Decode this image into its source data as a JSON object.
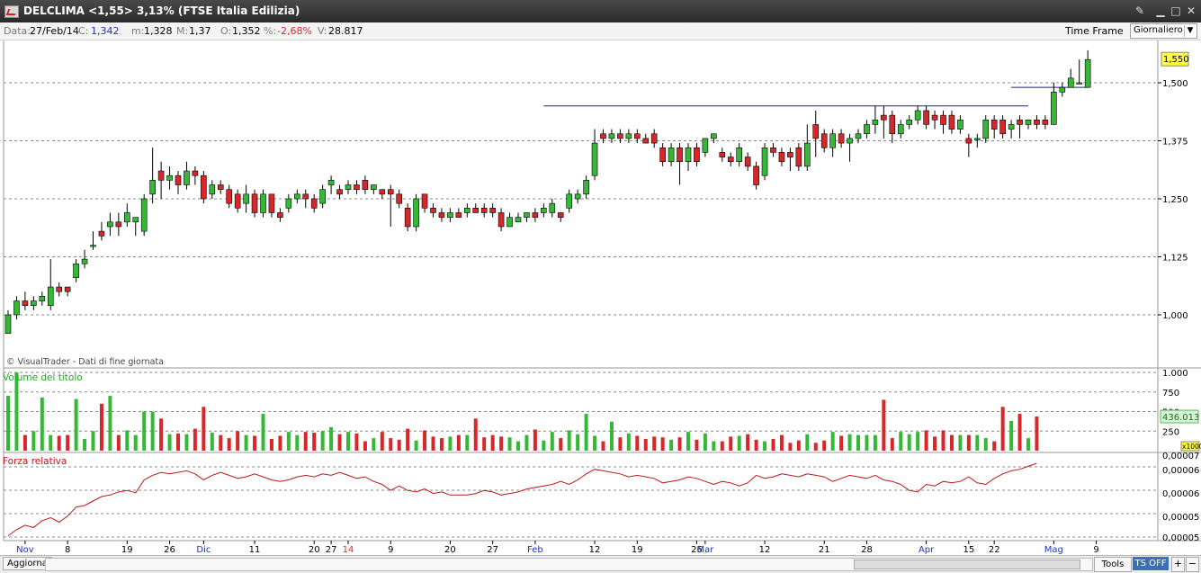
{
  "window": {
    "title": "DELCLIMA <1,55> 3,13%  (FTSE Italia Edilizia)"
  },
  "infobar": {
    "date_label": "Data:",
    "date_value": "27/Feb/14",
    "close_label": "C:",
    "close_value": "1,342",
    "min_label": "m:",
    "min_value": "1,328",
    "max_label": "M:",
    "max_value": "1,37",
    "open_label": "O:",
    "open_value": "1,352",
    "pct_label": "%:",
    "pct_value": "-2,68%",
    "vol_label": "V:",
    "vol_value": "28.817",
    "timeframe_label": "Time Frame",
    "timeframe_value": "Giornaliero"
  },
  "footer": {
    "refresh_label": "Aggiorna",
    "tools_label": "Tools",
    "ts_label": "TS OFF"
  },
  "colors": {
    "up": "#35b835",
    "down": "#d7272b",
    "line": "#1e1e96",
    "rs": "#c01818"
  },
  "chart_data": {
    "type": "candlestick",
    "copyright": "© VisualTrader - Dati di fine giornata",
    "price_axis": {
      "ticks": [
        1.0,
        1.125,
        1.25,
        1.375,
        1.5
      ],
      "labels": [
        "1,000",
        "1,125",
        "1,250",
        "1,375",
        "1,500"
      ],
      "last_label": "1,550",
      "last_value": 1.55
    },
    "date_labels": [
      {
        "i": 2,
        "label": "Nov",
        "color": "#2030c0"
      },
      {
        "i": 7,
        "label": "8"
      },
      {
        "i": 14,
        "label": "19"
      },
      {
        "i": 19,
        "label": "26"
      },
      {
        "i": 23,
        "label": "Dic",
        "color": "#2030c0"
      },
      {
        "i": 29,
        "label": "11"
      },
      {
        "i": 36,
        "label": "20"
      },
      {
        "i": 38,
        "label": "27"
      },
      {
        "i": 40,
        "label": "14",
        "color": "#e0282e"
      },
      {
        "i": 45,
        "label": "9"
      },
      {
        "i": 52,
        "label": "20"
      },
      {
        "i": 57,
        "label": "27"
      },
      {
        "i": 62,
        "label": "Feb",
        "color": "#2030c0"
      },
      {
        "i": 69,
        "label": "12"
      },
      {
        "i": 74,
        "label": "19"
      },
      {
        "i": 81,
        "label": "26"
      },
      {
        "i": 82,
        "label": "Mar",
        "color": "#2030c0"
      },
      {
        "i": 89,
        "label": "12"
      },
      {
        "i": 96,
        "label": "21"
      },
      {
        "i": 101,
        "label": "28"
      },
      {
        "i": 108,
        "label": "Apr",
        "color": "#2030c0"
      },
      {
        "i": 113,
        "label": "15"
      },
      {
        "i": 116,
        "label": "22"
      },
      {
        "i": 123,
        "label": "Mag",
        "color": "#2030c0"
      },
      {
        "i": 128,
        "label": "9"
      }
    ],
    "candles": [
      [
        0.96,
        1.0,
        0.96,
        1.01
      ],
      [
        1.0,
        1.03,
        0.99,
        1.04
      ],
      [
        1.03,
        1.02,
        1.01,
        1.05
      ],
      [
        1.02,
        1.03,
        1.01,
        1.04
      ],
      [
        1.03,
        1.04,
        1.02,
        1.05
      ],
      [
        1.02,
        1.06,
        1.01,
        1.12
      ],
      [
        1.06,
        1.05,
        1.04,
        1.07
      ],
      [
        1.06,
        1.05,
        1.04,
        1.06
      ],
      [
        1.08,
        1.11,
        1.07,
        1.12
      ],
      [
        1.11,
        1.12,
        1.1,
        1.14
      ],
      [
        1.15,
        1.15,
        1.14,
        1.18
      ],
      [
        1.18,
        1.17,
        1.16,
        1.2
      ],
      [
        1.19,
        1.2,
        1.17,
        1.22
      ],
      [
        1.2,
        1.19,
        1.17,
        1.22
      ],
      [
        1.2,
        1.22,
        1.19,
        1.24
      ],
      [
        1.2,
        1.21,
        1.17,
        1.21
      ],
      [
        1.18,
        1.25,
        1.17,
        1.26
      ],
      [
        1.26,
        1.29,
        1.24,
        1.36
      ],
      [
        1.31,
        1.29,
        1.25,
        1.33
      ],
      [
        1.29,
        1.3,
        1.27,
        1.32
      ],
      [
        1.3,
        1.28,
        1.26,
        1.31
      ],
      [
        1.28,
        1.31,
        1.27,
        1.33
      ],
      [
        1.31,
        1.3,
        1.28,
        1.32
      ],
      [
        1.3,
        1.25,
        1.24,
        1.31
      ],
      [
        1.26,
        1.28,
        1.25,
        1.29
      ],
      [
        1.28,
        1.27,
        1.26,
        1.29
      ],
      [
        1.27,
        1.24,
        1.23,
        1.28
      ],
      [
        1.26,
        1.23,
        1.22,
        1.27
      ],
      [
        1.24,
        1.26,
        1.22,
        1.28
      ],
      [
        1.26,
        1.22,
        1.21,
        1.27
      ],
      [
        1.22,
        1.26,
        1.21,
        1.27
      ],
      [
        1.26,
        1.22,
        1.21,
        1.26
      ],
      [
        1.22,
        1.21,
        1.2,
        1.23
      ],
      [
        1.23,
        1.25,
        1.22,
        1.26
      ],
      [
        1.25,
        1.26,
        1.24,
        1.27
      ],
      [
        1.26,
        1.25,
        1.23,
        1.27
      ],
      [
        1.25,
        1.23,
        1.22,
        1.26
      ],
      [
        1.24,
        1.27,
        1.23,
        1.28
      ],
      [
        1.28,
        1.29,
        1.26,
        1.3
      ],
      [
        1.27,
        1.26,
        1.25,
        1.28
      ],
      [
        1.27,
        1.28,
        1.26,
        1.29
      ],
      [
        1.28,
        1.27,
        1.26,
        1.29
      ],
      [
        1.29,
        1.27,
        1.26,
        1.3
      ],
      [
        1.27,
        1.28,
        1.26,
        1.28
      ],
      [
        1.27,
        1.26,
        1.25,
        1.27
      ],
      [
        1.27,
        1.26,
        1.19,
        1.28
      ],
      [
        1.26,
        1.24,
        1.23,
        1.27
      ],
      [
        1.23,
        1.19,
        1.18,
        1.24
      ],
      [
        1.19,
        1.25,
        1.18,
        1.26
      ],
      [
        1.26,
        1.23,
        1.22,
        1.26
      ],
      [
        1.23,
        1.22,
        1.21,
        1.24
      ],
      [
        1.22,
        1.21,
        1.2,
        1.23
      ],
      [
        1.21,
        1.22,
        1.2,
        1.23
      ],
      [
        1.22,
        1.21,
        1.21,
        1.23
      ],
      [
        1.22,
        1.23,
        1.21,
        1.24
      ],
      [
        1.23,
        1.22,
        1.22,
        1.24
      ],
      [
        1.23,
        1.22,
        1.21,
        1.24
      ],
      [
        1.23,
        1.22,
        1.21,
        1.24
      ],
      [
        1.22,
        1.19,
        1.18,
        1.23
      ],
      [
        1.19,
        1.21,
        1.19,
        1.22
      ],
      [
        1.2,
        1.21,
        1.2,
        1.22
      ],
      [
        1.21,
        1.22,
        1.2,
        1.22
      ],
      [
        1.22,
        1.21,
        1.2,
        1.23
      ],
      [
        1.22,
        1.23,
        1.21,
        1.24
      ],
      [
        1.22,
        1.24,
        1.21,
        1.25
      ],
      [
        1.22,
        1.21,
        1.2,
        1.22
      ],
      [
        1.23,
        1.26,
        1.22,
        1.27
      ],
      [
        1.25,
        1.26,
        1.24,
        1.27
      ],
      [
        1.26,
        1.29,
        1.25,
        1.3
      ],
      [
        1.3,
        1.37,
        1.29,
        1.4
      ],
      [
        1.39,
        1.38,
        1.37,
        1.4
      ],
      [
        1.38,
        1.39,
        1.37,
        1.4
      ],
      [
        1.39,
        1.38,
        1.37,
        1.4
      ],
      [
        1.38,
        1.39,
        1.37,
        1.4
      ],
      [
        1.39,
        1.38,
        1.37,
        1.4
      ],
      [
        1.38,
        1.37,
        1.37,
        1.39
      ],
      [
        1.39,
        1.37,
        1.36,
        1.4
      ],
      [
        1.36,
        1.33,
        1.32,
        1.37
      ],
      [
        1.33,
        1.36,
        1.32,
        1.37
      ],
      [
        1.36,
        1.33,
        1.28,
        1.37
      ],
      [
        1.33,
        1.36,
        1.31,
        1.37
      ],
      [
        1.36,
        1.33,
        1.32,
        1.37
      ],
      [
        1.35,
        1.38,
        1.34,
        1.38
      ],
      [
        1.38,
        1.39,
        1.37,
        1.39
      ],
      [
        1.35,
        1.34,
        1.33,
        1.36
      ],
      [
        1.34,
        1.33,
        1.32,
        1.35
      ],
      [
        1.33,
        1.36,
        1.32,
        1.37
      ],
      [
        1.34,
        1.32,
        1.31,
        1.35
      ],
      [
        1.32,
        1.28,
        1.27,
        1.33
      ],
      [
        1.3,
        1.36,
        1.29,
        1.37
      ],
      [
        1.36,
        1.35,
        1.34,
        1.37
      ],
      [
        1.35,
        1.33,
        1.32,
        1.36
      ],
      [
        1.35,
        1.34,
        1.31,
        1.36
      ],
      [
        1.36,
        1.32,
        1.31,
        1.37
      ],
      [
        1.32,
        1.37,
        1.31,
        1.41
      ],
      [
        1.41,
        1.38,
        1.34,
        1.44
      ],
      [
        1.39,
        1.36,
        1.35,
        1.4
      ],
      [
        1.36,
        1.39,
        1.34,
        1.4
      ],
      [
        1.39,
        1.37,
        1.36,
        1.4
      ],
      [
        1.37,
        1.38,
        1.33,
        1.39
      ],
      [
        1.38,
        1.39,
        1.37,
        1.4
      ],
      [
        1.39,
        1.41,
        1.38,
        1.42
      ],
      [
        1.41,
        1.42,
        1.39,
        1.45
      ],
      [
        1.43,
        1.42,
        1.38,
        1.45
      ],
      [
        1.43,
        1.39,
        1.37,
        1.44
      ],
      [
        1.39,
        1.41,
        1.38,
        1.42
      ],
      [
        1.41,
        1.42,
        1.4,
        1.43
      ],
      [
        1.42,
        1.44,
        1.41,
        1.45
      ],
      [
        1.44,
        1.41,
        1.4,
        1.45
      ],
      [
        1.43,
        1.42,
        1.4,
        1.44
      ],
      [
        1.43,
        1.41,
        1.39,
        1.44
      ],
      [
        1.43,
        1.4,
        1.39,
        1.44
      ],
      [
        1.4,
        1.42,
        1.39,
        1.43
      ],
      [
        1.38,
        1.37,
        1.34,
        1.39
      ],
      [
        1.38,
        1.38,
        1.36,
        1.39
      ],
      [
        1.38,
        1.42,
        1.37,
        1.43
      ],
      [
        1.42,
        1.4,
        1.38,
        1.43
      ],
      [
        1.42,
        1.39,
        1.38,
        1.43
      ],
      [
        1.4,
        1.41,
        1.38,
        1.42
      ],
      [
        1.42,
        1.41,
        1.38,
        1.43
      ],
      [
        1.41,
        1.42,
        1.4,
        1.42
      ],
      [
        1.42,
        1.41,
        1.4,
        1.43
      ],
      [
        1.42,
        1.41,
        1.4,
        1.43
      ],
      [
        1.41,
        1.48,
        1.41,
        1.5
      ],
      [
        1.48,
        1.49,
        1.47,
        1.5
      ],
      [
        1.49,
        1.51,
        1.49,
        1.53
      ],
      [
        1.5,
        1.5,
        1.5,
        1.55
      ],
      [
        1.49,
        1.55,
        1.49,
        1.57
      ]
    ],
    "resistance_lines": [
      {
        "from": 63,
        "to": 120,
        "value": 1.45
      },
      {
        "from": 118,
        "to": 127,
        "value": 1.49
      }
    ],
    "volume": {
      "title": "Volume del titolo",
      "ticks": [
        250,
        500,
        750,
        1000
      ],
      "labels": [
        "250",
        "500",
        "750",
        "1.000"
      ],
      "last_label": "436.013",
      "unit_label": "x1000",
      "values": [
        700,
        1000,
        200,
        250,
        680,
        200,
        190,
        200,
        660,
        150,
        250,
        600,
        700,
        200,
        260,
        200,
        500,
        500,
        410,
        210,
        220,
        210,
        280,
        560,
        230,
        200,
        160,
        250,
        200,
        190,
        470,
        150,
        190,
        240,
        200,
        240,
        230,
        250,
        300,
        210,
        240,
        220,
        120,
        160,
        240,
        160,
        140,
        280,
        130,
        260,
        180,
        160,
        180,
        200,
        200,
        410,
        170,
        200,
        180,
        170,
        120,
        200,
        270,
        130,
        240,
        160,
        260,
        210,
        470,
        190,
        120,
        370,
        170,
        220,
        190,
        150,
        180,
        170,
        140,
        170,
        240,
        140,
        220,
        120,
        120,
        180,
        190,
        210,
        140,
        120,
        150,
        200,
        100,
        130,
        210,
        100,
        130,
        240,
        190,
        210,
        200,
        200,
        200,
        650,
        160,
        240,
        210,
        240,
        260,
        180,
        260,
        200,
        200,
        200,
        200,
        160,
        120,
        560,
        380,
        470,
        160,
        436
      ]
    },
    "relative_strength": {
      "title": "Forza relativa",
      "labels": [
        "0,00007",
        "0,00006",
        "0,00006",
        "0,00005",
        "0,00005"
      ],
      "values": [
        0.04,
        0.12,
        0.18,
        0.15,
        0.24,
        0.28,
        0.22,
        0.3,
        0.42,
        0.44,
        0.5,
        0.56,
        0.58,
        0.62,
        0.64,
        0.61,
        0.78,
        0.84,
        0.88,
        0.86,
        0.88,
        0.9,
        0.86,
        0.78,
        0.84,
        0.88,
        0.84,
        0.8,
        0.82,
        0.86,
        0.82,
        0.78,
        0.76,
        0.78,
        0.82,
        0.84,
        0.82,
        0.86,
        0.84,
        0.88,
        0.84,
        0.8,
        0.82,
        0.76,
        0.72,
        0.64,
        0.7,
        0.64,
        0.62,
        0.66,
        0.6,
        0.62,
        0.58,
        0.58,
        0.58,
        0.6,
        0.64,
        0.62,
        0.58,
        0.6,
        0.62,
        0.66,
        0.68,
        0.7,
        0.72,
        0.76,
        0.72,
        0.78,
        0.86,
        0.92,
        0.9,
        0.88,
        0.86,
        0.82,
        0.84,
        0.82,
        0.8,
        0.74,
        0.76,
        0.78,
        0.82,
        0.8,
        0.76,
        0.72,
        0.76,
        0.74,
        0.7,
        0.74,
        0.84,
        0.8,
        0.82,
        0.86,
        0.84,
        0.82,
        0.86,
        0.84,
        0.82,
        0.76,
        0.8,
        0.84,
        0.82,
        0.8,
        0.84,
        0.78,
        0.76,
        0.72,
        0.64,
        0.62,
        0.72,
        0.7,
        0.76,
        0.74,
        0.76,
        0.82,
        0.74,
        0.72,
        0.8,
        0.86,
        0.9,
        0.92,
        0.96,
        1.0
      ]
    }
  }
}
